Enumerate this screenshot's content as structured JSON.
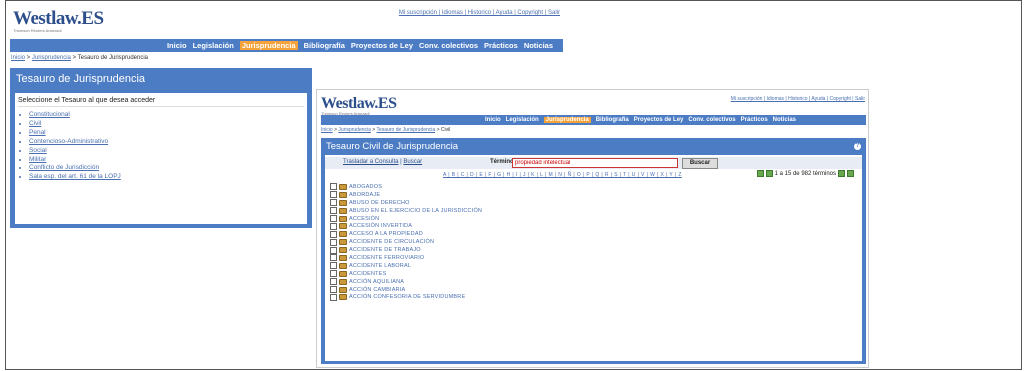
{
  "back_window": {
    "logo": "Westlaw.ES",
    "logo_sub": "Thomson Reuters Aranzadi",
    "top_links": "Mi suscripción | Idiomas | Historico | Ayuda | Copyright | Salir",
    "nav": [
      "Inicio",
      "Legislación",
      "Jurisprudencia",
      "Bibliografía",
      "Proyectos de Ley",
      "Conv. colectivos",
      "Prácticos",
      "Noticias"
    ],
    "active_nav": "Jurisprudencia",
    "breadcrumb": {
      "home": "Inicio",
      "sep1": " > ",
      "link": "Jurisprudencia",
      "sep2": " > ",
      "current": "Tesauro de Jurisprudencia"
    },
    "panel_title": "Tesauro de Jurisprudencia",
    "intro": "Seleccione el Tesauro al que desea acceder",
    "items": [
      "Constitucional",
      "Civil",
      "Penal",
      "Contencioso-Administrativo",
      "Social",
      "Militar",
      "Conflicto de Jurisdicción",
      "Sala esp. del art. 61 de la LOPJ"
    ]
  },
  "front_window": {
    "logo": "Westlaw.ES",
    "logo_sub": "Thomson Reuters Aranzadi",
    "top_links": "Mi suscripción | Idiomas | Historico | Ayuda | Copyright | Salir",
    "nav": [
      "Inicio",
      "Legislación",
      "Jurisprudencia",
      "Bibliografía",
      "Proyectos de Ley",
      "Conv. colectivos",
      "Prácticos",
      "Noticias"
    ],
    "active_nav": "Jurisprudencia",
    "breadcrumb": {
      "home": "Inicio",
      "sep1": " > ",
      "link1": "Jurisprudencia",
      "sep2": " > ",
      "link2": "Tesauro de Jurisprudencia",
      "sep3": " > ",
      "current": "Civil"
    },
    "panel_title": "Tesauro Civil de Jurisprudencia",
    "help": "?",
    "tool_link1": "Trasladar a Consulta",
    "tool_sep": " | ",
    "tool_link2": "Buscar",
    "term_label": "Término",
    "term_value": "propiedad intelectual",
    "search_button": "Buscar",
    "alphabet": "A | B | C | D | E | F | G | H | I | J | K | L | M | N | Ñ | O | P | Q | R | S | T | U | V | W | X | Y | Z",
    "pager_text": "1 a 15 de 982 términos",
    "terms": [
      "ABOGADOS",
      "ABORDAJE",
      "ABUSO DE DERECHO",
      "ABUSO EN EL EJERCICIO DE LA JURISDICCIÓN",
      "ACCESIÓN",
      "ACCESIÓN INVERTIDA",
      "ACCESO A LA PROPIEDAD",
      "ACCIDENTE DE CIRCULACIÓN",
      "ACCIDENTE DE TRABAJO",
      "ACCIDENTE FERROVIARIO",
      "ACCIDENTE LABORAL",
      "ACCIDENTES",
      "ACCIÓN AQUILIANA",
      "ACCIÓN CAMBIARIA",
      "ACCIÓN CONFESORIA DE SERVIDUMBRE"
    ]
  }
}
